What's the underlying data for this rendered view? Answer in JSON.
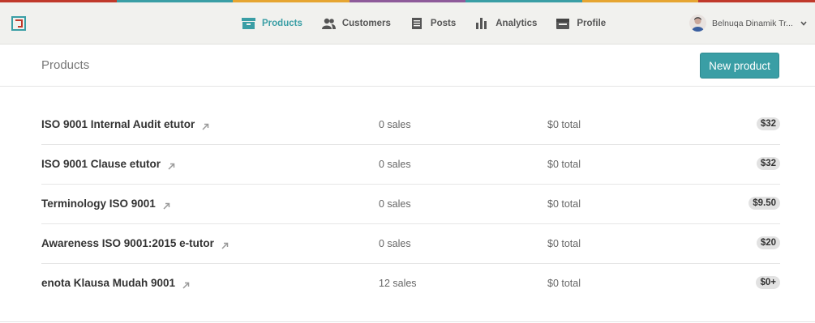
{
  "colors": {
    "accent": "#3a9ea5",
    "top_stripe": [
      "#c0392b",
      "#3a9ea5",
      "#e6a531",
      "#8e5b9a",
      "#3a9ea5",
      "#e6a531",
      "#c0392b"
    ]
  },
  "nav": {
    "items": [
      {
        "label": "Products",
        "icon": "box-icon",
        "active": true
      },
      {
        "label": "Customers",
        "icon": "users-icon",
        "active": false
      },
      {
        "label": "Posts",
        "icon": "document-icon",
        "active": false
      },
      {
        "label": "Analytics",
        "icon": "bar-chart-icon",
        "active": false
      },
      {
        "label": "Profile",
        "icon": "profile-card-icon",
        "active": false
      }
    ]
  },
  "user": {
    "name": "Belnuqa Dinamik Tr...",
    "icon": "chevron-down-icon"
  },
  "header": {
    "title": "Products",
    "new_product_label": "New product"
  },
  "products": [
    {
      "name": "ISO 9001 Internal Audit etutor",
      "sales": "0 sales",
      "total": "$0 total",
      "price": "$32"
    },
    {
      "name": "ISO 9001 Clause etutor",
      "sales": "0 sales",
      "total": "$0 total",
      "price": "$32"
    },
    {
      "name": "Terminology ISO 9001",
      "sales": "0 sales",
      "total": "$0 total",
      "price": "$9.50"
    },
    {
      "name": "Awareness ISO 9001:2015 e-tutor",
      "sales": "0 sales",
      "total": "$0 total",
      "price": "$20"
    },
    {
      "name": "enota Klausa Mudah 9001",
      "sales": "12 sales",
      "total": "$0 total",
      "price": "$0+"
    }
  ]
}
